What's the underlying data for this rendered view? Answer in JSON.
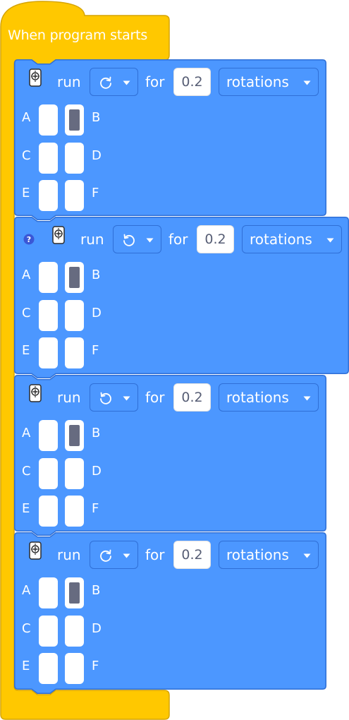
{
  "hat_block": {
    "label": "When program starts"
  },
  "motor_blocks": [
    {
      "show_help": false,
      "run_label": "run",
      "direction_icon": "rotate-clockwise-icon",
      "for_label": "for",
      "value": "0.2",
      "unit_label": "rotations",
      "selected_port": "B"
    },
    {
      "show_help": true,
      "run_label": "run",
      "direction_icon": "rotate-counterclockwise-icon",
      "for_label": "for",
      "value": "0.2",
      "unit_label": "rotations",
      "selected_port": "B"
    },
    {
      "show_help": false,
      "run_label": "run",
      "direction_icon": "rotate-counterclockwise-icon",
      "for_label": "for",
      "value": "0.2",
      "unit_label": "rotations",
      "selected_port": "B"
    },
    {
      "show_help": false,
      "run_label": "run",
      "direction_icon": "rotate-clockwise-icon",
      "for_label": "for",
      "value": "0.2",
      "unit_label": "rotations",
      "selected_port": "B"
    }
  ],
  "ports": [
    [
      "A",
      "B"
    ],
    [
      "C",
      "D"
    ],
    [
      "E",
      "F"
    ]
  ],
  "colors": {
    "hat_fill": "#ffc800",
    "hat_stroke": "#d6a400",
    "block_fill": "#4c97ff",
    "block_stroke": "#2f6fd6",
    "field_bg": "#ffffff",
    "field_text": "#575e75",
    "port_selected": "#676b80",
    "help_fill": "#3a57d6"
  }
}
